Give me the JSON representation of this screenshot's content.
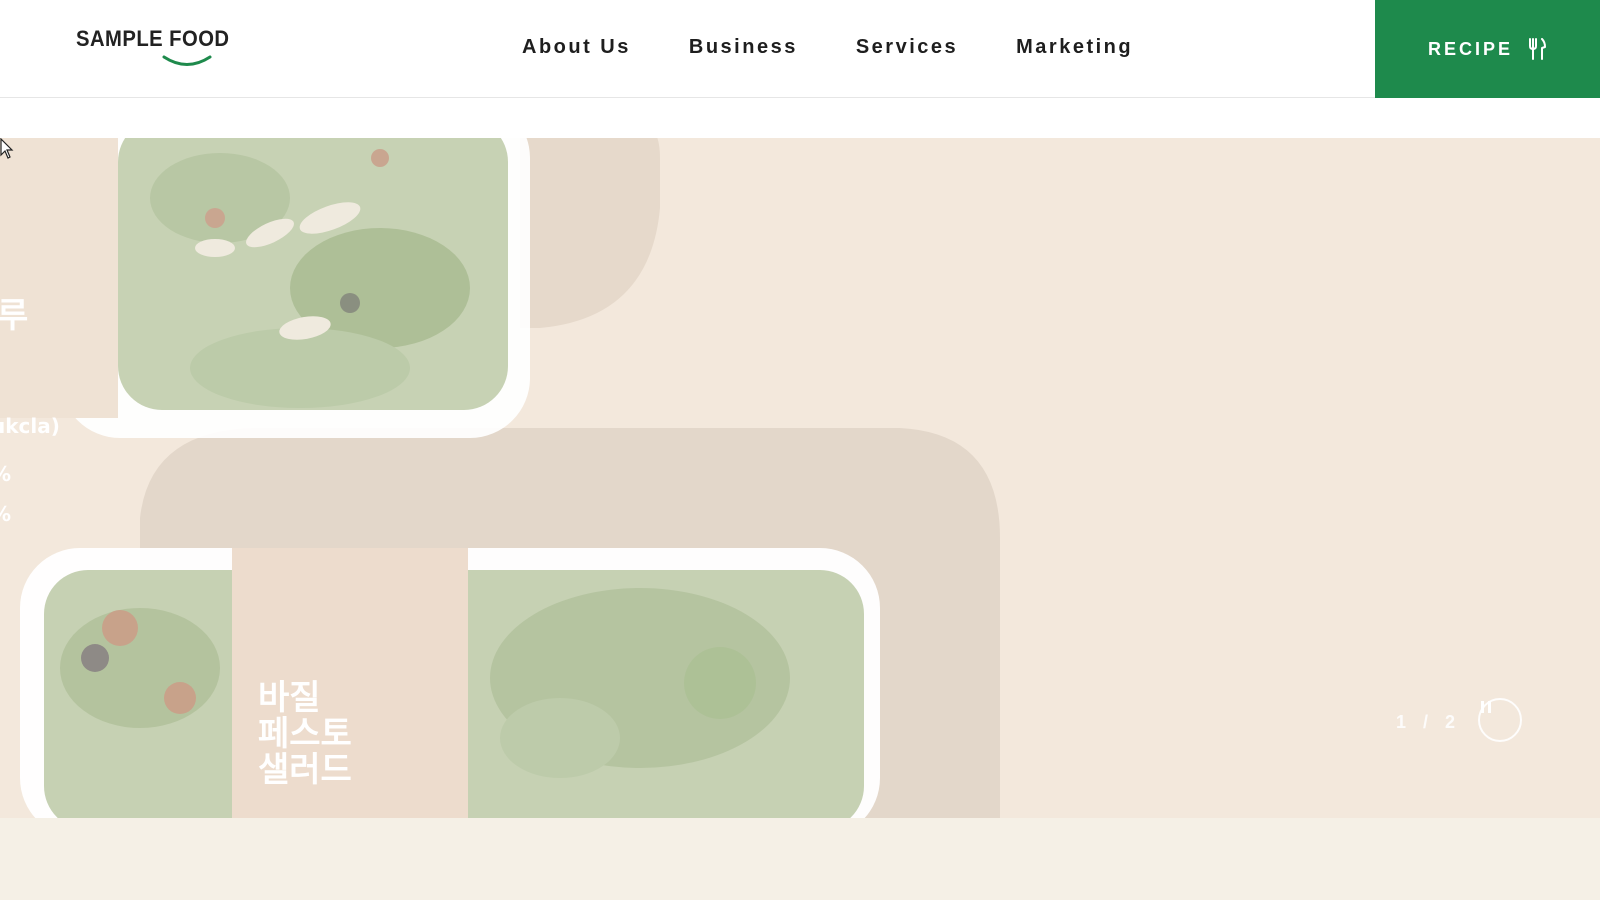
{
  "header": {
    "logo_text": "SAMPLE FOOD",
    "nav": [
      "About Us",
      "Business",
      "Services",
      "Marketing"
    ],
    "cta_label": "RECIPE"
  },
  "hero": {
    "product_title_lines": [
      "바질",
      "페스토",
      "샐러드"
    ],
    "left_cut_text": {
      "k1": "루",
      "k2": "ukcla)",
      "k3": "%",
      "k4": "%"
    },
    "pager": "1 / 2"
  },
  "colors": {
    "brand_green": "#1e8a4c",
    "hero_bg": "#f3e8dc",
    "page_bg": "#f5f0e6"
  },
  "icons": {
    "recipe": "fork-knife-icon",
    "pause": "pause-icon"
  }
}
